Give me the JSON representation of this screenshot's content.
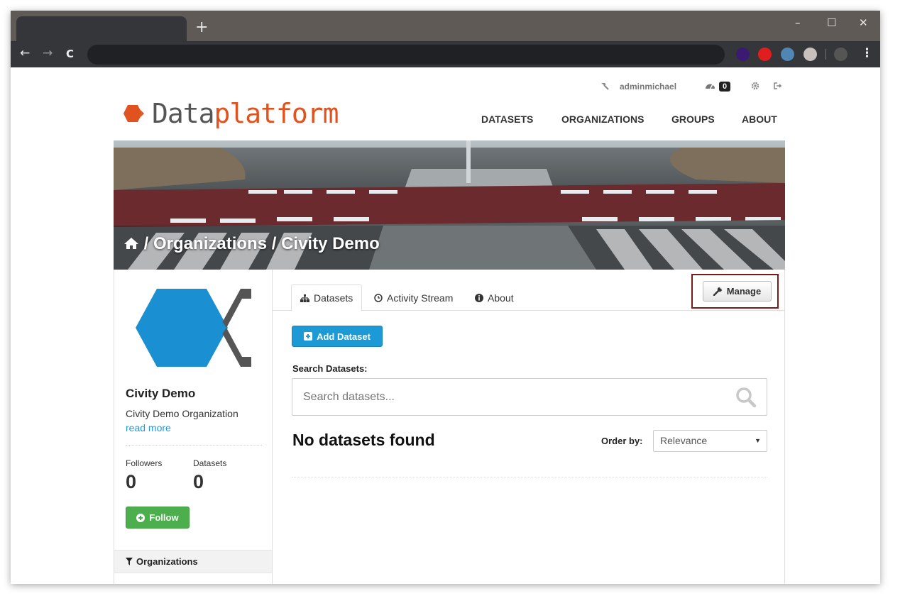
{
  "browser": {
    "new_tab": "+",
    "minimize": "–",
    "maximize": "☐",
    "close": "✕",
    "back": "←",
    "forward": "→",
    "reload": "C",
    "menu": "⋮",
    "extension_colors": [
      "#3a1a73",
      "#e01e1e",
      "#4f86b4",
      "#c8c0bc",
      "#555555"
    ]
  },
  "header": {
    "username": "adminmichael",
    "notification_count": "0",
    "logo_part1": "Data",
    "logo_part2": "platform",
    "nav": [
      "DATASETS",
      "ORGANIZATIONS",
      "GROUPS",
      "ABOUT"
    ]
  },
  "breadcrumb": {
    "sep1": "/",
    "organizations": "Organizations",
    "sep2": "/",
    "current": "Civity Demo"
  },
  "sidebar": {
    "org_name": "Civity Demo",
    "org_description": "Civity Demo Organization",
    "read_more": "read more",
    "followers_label": "Followers",
    "followers_value": "0",
    "datasets_label": "Datasets",
    "datasets_value": "0",
    "follow_label": "Follow",
    "facet_title": "Organizations"
  },
  "main": {
    "tabs": [
      {
        "label": "Datasets",
        "icon": "sitemap-icon"
      },
      {
        "label": "Activity Stream",
        "icon": "clock-icon"
      },
      {
        "label": "About",
        "icon": "info-icon"
      }
    ],
    "manage_label": "Manage",
    "add_dataset_label": "Add Dataset",
    "search_label": "Search Datasets:",
    "search_placeholder": "Search datasets...",
    "results_title": "No datasets found",
    "order_by_label": "Order by:",
    "order_by_value": "Relevance"
  },
  "colors": {
    "brand_orange": "#e0531f",
    "link_blue": "#1a9bd7",
    "primary_button": "#1c9ad6",
    "follow_green": "#4cae4c",
    "highlight_border": "#7a1a1a"
  }
}
